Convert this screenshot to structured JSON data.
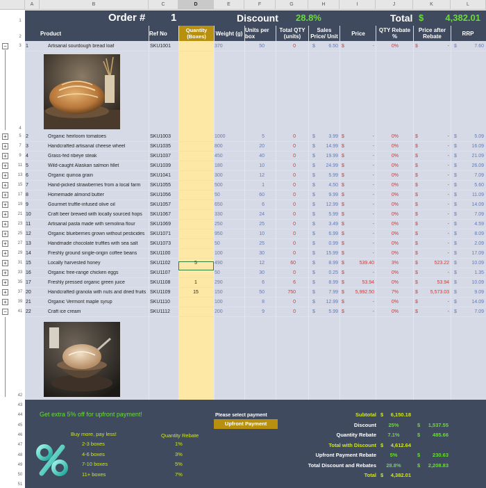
{
  "columns": [
    "A",
    "B",
    "C",
    "D",
    "E",
    "F",
    "G",
    "H",
    "I",
    "J",
    "K",
    "L"
  ],
  "selected_column": "D",
  "header": {
    "order_label": "Order #",
    "order_value": "1",
    "discount_label": "Discount",
    "discount_value": "28.8%",
    "total_label": "Total",
    "total_currency": "$",
    "total_value": "4,382.01"
  },
  "column_headers": {
    "product": "Product",
    "ref": "Ref No",
    "qty": "Quantity (Boxes)",
    "weight": "Weight (g)",
    "units": "Units per box",
    "total_qty": "Total QTY (units)",
    "sales_price": "Sales Price/ Unit",
    "price": "Price",
    "qty_rebate": "QTY Rebate %",
    "price_after": "Price after Rebate",
    "rrp": "RRP"
  },
  "products": [
    {
      "row": "3",
      "n": "1",
      "name": "Artisanal sourdough bread loaf",
      "ref": "SKU1001",
      "qty": "",
      "weight": "370",
      "units": "50",
      "tq": "0",
      "sp": "6.50",
      "price": "-",
      "reb": "0%",
      "par": "-",
      "rrp": "7.60"
    },
    {
      "row": "5",
      "n": "2",
      "name": "Organic heirloom tomatoes",
      "ref": "SKU1003",
      "qty": "",
      "weight": "1000",
      "units": "5",
      "tq": "0",
      "sp": "3.99",
      "price": "-",
      "reb": "0%",
      "par": "-",
      "rrp": "5.09"
    },
    {
      "row": "7",
      "n": "3",
      "name": "Handcrafted artisanal cheese wheel",
      "ref": "SKU1035",
      "qty": "",
      "weight": "800",
      "units": "20",
      "tq": "0",
      "sp": "14.99",
      "price": "-",
      "reb": "0%",
      "par": "-",
      "rrp": "16.09"
    },
    {
      "row": "9",
      "n": "4",
      "name": "Grass-fed ribeye steak",
      "ref": "SKU1037",
      "qty": "",
      "weight": "450",
      "units": "40",
      "tq": "0",
      "sp": "19.99",
      "price": "-",
      "reb": "0%",
      "par": "-",
      "rrp": "21.09"
    },
    {
      "row": "11",
      "n": "5",
      "name": "Wild-caught Alaskan salmon fillet",
      "ref": "SKU1039",
      "qty": "",
      "weight": "180",
      "units": "10",
      "tq": "0",
      "sp": "24.99",
      "price": "-",
      "reb": "0%",
      "par": "-",
      "rrp": "26.09"
    },
    {
      "row": "13",
      "n": "6",
      "name": "Organic quinoa grain",
      "ref": "SKU1041",
      "qty": "",
      "weight": "300",
      "units": "12",
      "tq": "0",
      "sp": "5.99",
      "price": "-",
      "reb": "0%",
      "par": "-",
      "rrp": "7.09"
    },
    {
      "row": "15",
      "n": "7",
      "name": "Hand-picked strawberries from a local farm",
      "ref": "SKU1055",
      "qty": "",
      "weight": "500",
      "units": "1",
      "tq": "0",
      "sp": "4.50",
      "price": "-",
      "reb": "0%",
      "par": "-",
      "rrp": "5.60"
    },
    {
      "row": "17",
      "n": "8",
      "name": "Homemade almond butter",
      "ref": "SKU1056",
      "qty": "",
      "weight": "50",
      "units": "60",
      "tq": "0",
      "sp": "9.99",
      "price": "-",
      "reb": "0%",
      "par": "-",
      "rrp": "11.09"
    },
    {
      "row": "19",
      "n": "9",
      "name": "Gourmet truffle-infused olive oil",
      "ref": "SKU1057",
      "qty": "",
      "weight": "650",
      "units": "6",
      "tq": "0",
      "sp": "12.99",
      "price": "-",
      "reb": "0%",
      "par": "-",
      "rrp": "14.09"
    },
    {
      "row": "21",
      "n": "10",
      "name": "Craft beer brewed with locally sourced hops",
      "ref": "SKU1067",
      "qty": "",
      "weight": "330",
      "units": "24",
      "tq": "0",
      "sp": "5.99",
      "price": "-",
      "reb": "0%",
      "par": "-",
      "rrp": "7.09"
    },
    {
      "row": "23",
      "n": "11",
      "name": "Artisanal pasta made with semolina flour",
      "ref": "SKU1069",
      "qty": "",
      "weight": "250",
      "units": "25",
      "tq": "0",
      "sp": "3.49",
      "price": "-",
      "reb": "0%",
      "par": "-",
      "rrp": "4.59"
    },
    {
      "row": "25",
      "n": "12",
      "name": "Organic blueberries grown without pesticides",
      "ref": "SKU1071",
      "qty": "",
      "weight": "950",
      "units": "10",
      "tq": "0",
      "sp": "6.99",
      "price": "-",
      "reb": "0%",
      "par": "-",
      "rrp": "8.09"
    },
    {
      "row": "27",
      "n": "13",
      "name": "Handmade chocolate truffles with sea salt",
      "ref": "SKU1073",
      "qty": "",
      "weight": "50",
      "units": "25",
      "tq": "0",
      "sp": "0.99",
      "price": "-",
      "reb": "0%",
      "par": "-",
      "rrp": "2.09"
    },
    {
      "row": "29",
      "n": "14",
      "name": "Freshly ground single-origin coffee beans",
      "ref": "SKU1100",
      "qty": "",
      "weight": "100",
      "units": "30",
      "tq": "0",
      "sp": "15.99",
      "price": "-",
      "reb": "0%",
      "par": "-",
      "rrp": "17.09"
    },
    {
      "row": "31",
      "n": "15",
      "name": "Locally harvested honey",
      "ref": "SKU1102",
      "qty": "5",
      "weight": "490",
      "units": "12",
      "tq": "60",
      "sp": "8.99",
      "price": "539.40",
      "reb": "3%",
      "par": "523.22",
      "rrp": "10.09"
    },
    {
      "row": "33",
      "n": "16",
      "name": "Organic free-range chicken eggs",
      "ref": "SKU1107",
      "qty": "",
      "weight": "50",
      "units": "30",
      "tq": "0",
      "sp": "0.25",
      "price": "-",
      "reb": "0%",
      "par": "-",
      "rrp": "1.35"
    },
    {
      "row": "35",
      "n": "17",
      "name": "Freshly pressed organic green juice",
      "ref": "SKU1108",
      "qty": "1",
      "weight": "290",
      "units": "6",
      "tq": "6",
      "sp": "8.99",
      "price": "53.94",
      "reb": "0%",
      "par": "53.94",
      "rrp": "10.09"
    },
    {
      "row": "37",
      "n": "20",
      "name": "Handcrafted granola with nuts and dried fruits",
      "ref": "SKU1109",
      "qty": "15",
      "weight": "150",
      "units": "50",
      "tq": "750",
      "sp": "7.99",
      "price": "5,992.50",
      "reb": "7%",
      "par": "5,573.03",
      "rrp": "9.09"
    },
    {
      "row": "39",
      "n": "21",
      "name": "Organic Vermont maple syrup",
      "ref": "SKU1110",
      "qty": "",
      "weight": "100",
      "units": "8",
      "tq": "0",
      "sp": "12.99",
      "price": "-",
      "reb": "0%",
      "par": "-",
      "rrp": "14.09"
    },
    {
      "row": "41",
      "n": "22",
      "name": "Craft ice cream",
      "ref": "SKU1112",
      "qty": "",
      "weight": "200",
      "units": "9",
      "tq": "0",
      "sp": "5.99",
      "price": "-",
      "reb": "0%",
      "par": "-",
      "rrp": "7.09"
    }
  ],
  "row_numbers": {
    "r1": "1",
    "r2": "2",
    "r4": "4",
    "r42": "42",
    "r43": "43",
    "r44": "44",
    "r45": "45",
    "r46": "46",
    "r47": "47",
    "r48": "48",
    "r49": "49",
    "r50": "50",
    "r51": "51"
  },
  "currency": "$",
  "footer": {
    "promo": "Get extra 5% off for upfront payment!",
    "buy_more": "Buy more, pay less!",
    "rebate_header": "Quantity Rebate",
    "tiers": [
      {
        "boxes": "2-3 boxes",
        "rebate": "1%"
      },
      {
        "boxes": "4-6 boxes",
        "rebate": "3%"
      },
      {
        "boxes": "7-10 boxes",
        "rebate": "5%"
      },
      {
        "boxes": "11+ boxes",
        "rebate": "7%"
      }
    ],
    "payment_prompt": "Please select payment",
    "payment_option": "Upfront Payment",
    "summary": {
      "subtotal_label": "Subtotal",
      "subtotal_value": "6,150.18",
      "discount_label": "Discount",
      "discount_pct": "25%",
      "discount_value": "1,537.55",
      "qty_rebate_label": "Quantity Rebate",
      "qty_rebate_pct": "7.1%",
      "qty_rebate_value": "485.66",
      "with_discount_label": "Total with Discount",
      "with_discount_value": "4,612.64",
      "upfront_label": "Upfront Payment Rebate",
      "upfront_pct": "5%",
      "upfront_value": "230.63",
      "total_disc_label": "Total Discount and Rebates",
      "total_disc_pct": "28.8%",
      "total_disc_value": "2,208.83",
      "total_label": "Total",
      "total_value": "4,382.01"
    }
  },
  "colors": {
    "dark": "#3f4a5e",
    "light": "#d6dae6",
    "qty_col": "#fde8a6",
    "qty_head": "#b8900f",
    "green": "#6adc3a",
    "lime": "#cfe52a"
  }
}
